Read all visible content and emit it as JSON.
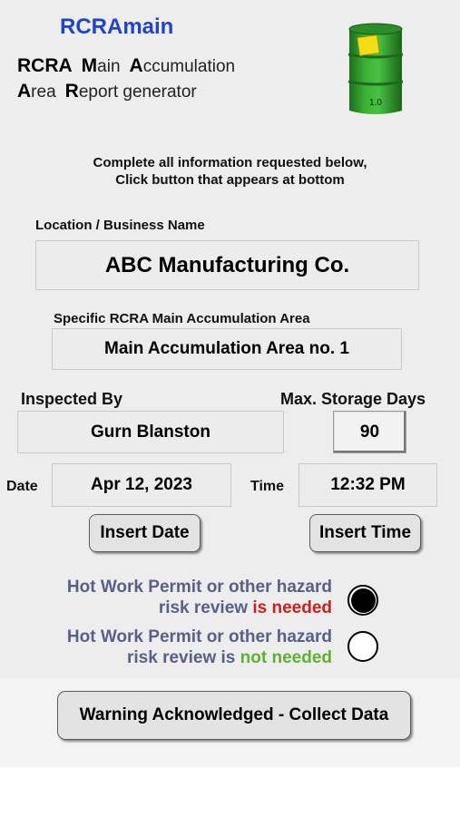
{
  "header": {
    "app_title": "RCRAmain",
    "subtitle_line1": {
      "w1_cap": "RCRA",
      "w2_cap": "M",
      "w2_rest": "ain",
      "w3_cap": "A",
      "w3_rest": "ccumulation"
    },
    "subtitle_line2": {
      "w1_cap": "A",
      "w1_rest": "rea",
      "w2_cap": "R",
      "w2_rest": "eport generator"
    },
    "barrel_version": "1.0"
  },
  "instructions": {
    "line1": "Complete all information requested below,",
    "line2": "Click button that appears at bottom"
  },
  "form": {
    "location_label": "Location / Business Name",
    "location_value": "ABC Manufacturing Co.",
    "area_label": "Specific RCRA Main Accumulation Area",
    "area_value": "Main Accumulation Area no. 1",
    "inspected_by_label": "Inspected By",
    "inspected_by_value": "Gurn Blanston",
    "max_storage_label": "Max. Storage Days",
    "max_storage_value": "90",
    "date_label": "Date",
    "date_value": "Apr 12, 2023",
    "time_label": "Time",
    "time_value": "12:32 PM",
    "insert_date_button": "Insert Date",
    "insert_time_button": "Insert Time"
  },
  "hazard_review": {
    "option_needed": {
      "line1": "Hot Work Permit or other hazard",
      "line2_prefix": "risk review ",
      "line2_emph": "is needed",
      "selected": true
    },
    "option_not_needed": {
      "line1": "Hot Work Permit or other hazard",
      "line2_prefix": "risk review is ",
      "line2_emph": "not needed",
      "selected": false
    }
  },
  "footer": {
    "acknowledge_button": "Warning Acknowledged - Collect Data"
  },
  "colors": {
    "title_blue": "#1f44c8",
    "radio_text": "#5a5f86",
    "needed_red": "#c9201e",
    "not_needed_green": "#5fb030",
    "barrel_green": "#2f9a2b",
    "label_yellow": "#f1de16"
  }
}
